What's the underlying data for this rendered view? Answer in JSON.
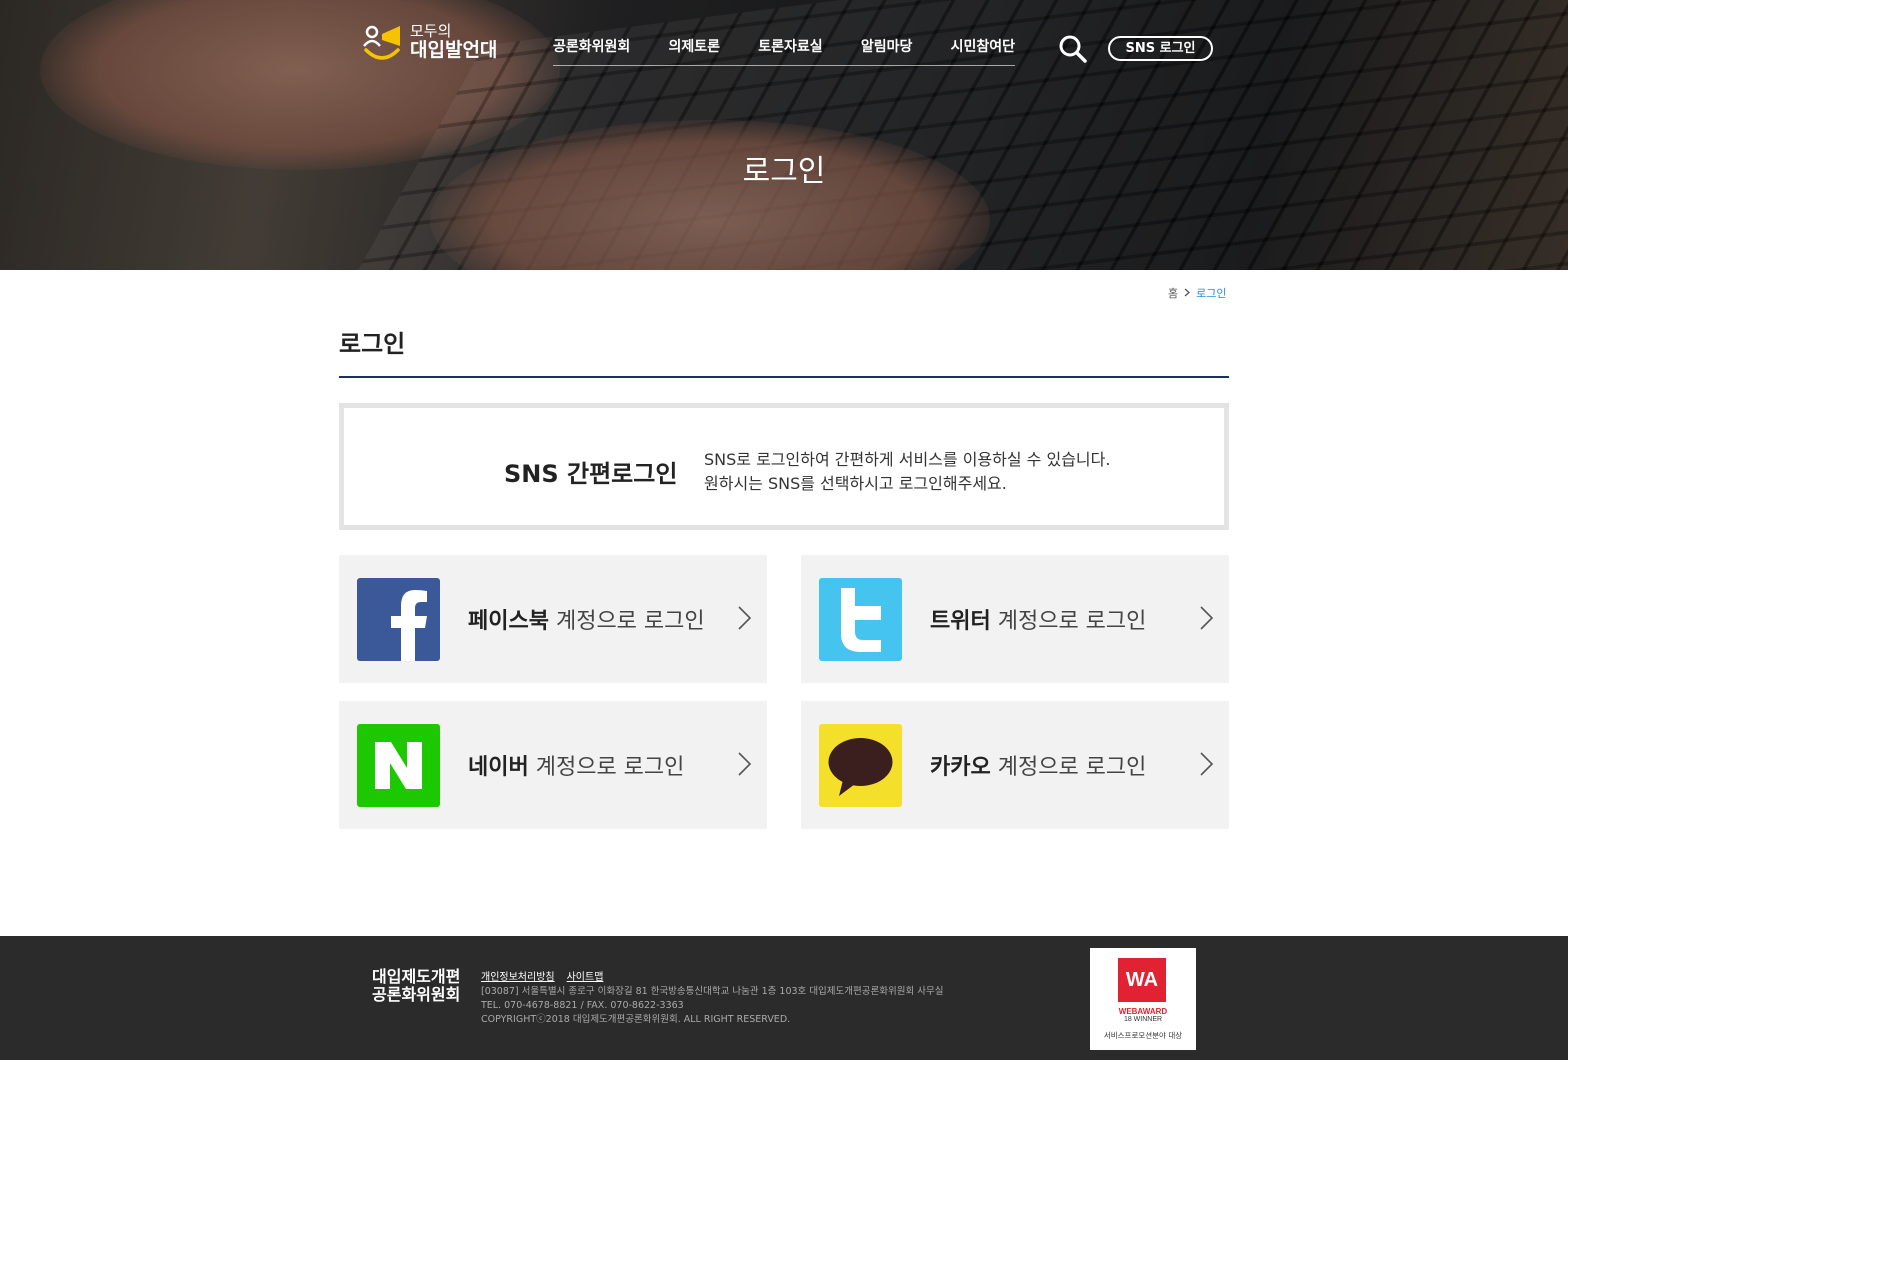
{
  "header": {
    "logo_line1": "모두의",
    "logo_line2": "대입발언대",
    "nav": [
      "공론화위원회",
      "의제토론",
      "토론자료실",
      "알림마당",
      "시민참여단"
    ],
    "sns_login_button": "SNS 로그인",
    "hero_title": "로그인"
  },
  "breadcrumb": {
    "home": "홈",
    "current": "로그인"
  },
  "page_title": "로그인",
  "info_box": {
    "heading": "SNS 간편로그인",
    "line1": "SNS로 로그인하여 간편하게 서비스를 이용하실 수 있습니다.",
    "line2": "원하시는 SNS를 선택하시고 로그인해주세요."
  },
  "sns_buttons": [
    {
      "name": "페이스북",
      "suffix": " 계정으로 로그인",
      "icon": "facebook-icon",
      "color": "#3b5998"
    },
    {
      "name": "트위터",
      "suffix": " 계정으로 로그인",
      "icon": "twitter-icon",
      "color": "#45c4f0"
    },
    {
      "name": "네이버",
      "suffix": " 계정으로 로그인",
      "icon": "naver-icon",
      "color": "#1ec800"
    },
    {
      "name": "카카오",
      "suffix": " 계정으로 로그인",
      "icon": "kakao-icon",
      "color": "#f4df2a"
    }
  ],
  "footer": {
    "logo_line1": "대입제도개편",
    "logo_line2": "공론화위원회",
    "links": [
      "개인정보처리방침",
      "사이트맵"
    ],
    "address": "[03087] 서울특별시 종로구 이화장길 81 한국방송통신대학교 나눔관 1층 103호 대입제도개편공론화위원회 사무실",
    "contact": "TEL. 070-4678-8821 / FAX. 070-8622-3363",
    "copyright": "COPYRIGHTⓒ2018 대입제도개편공론화위원회. ALL RIGHT RESERVED.",
    "award": {
      "logo": "WA",
      "line1": "WEBAWARD",
      "line2": "18 WINNER",
      "line3": "서비스프로모션분야 대상"
    }
  }
}
